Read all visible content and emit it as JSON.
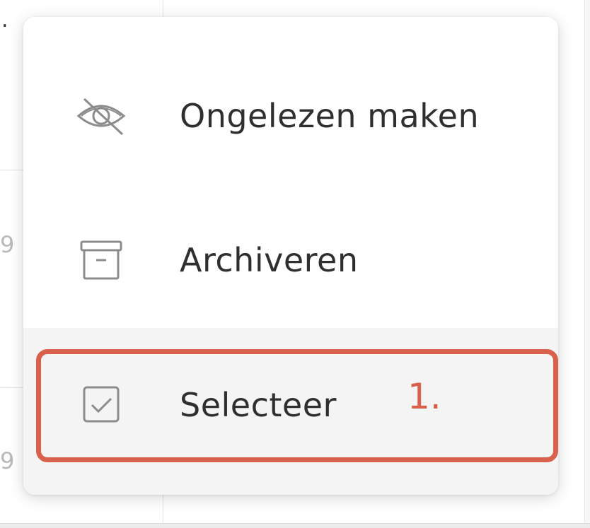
{
  "background": {
    "fragments": [
      "9",
      "9"
    ]
  },
  "menu": {
    "items": [
      {
        "label": "Ongelezen maken",
        "icon": "eye-off-icon"
      },
      {
        "label": "Archiveren",
        "icon": "archive-box-icon"
      },
      {
        "label": "Selecteer",
        "icon": "checkbox-checked-icon"
      }
    ]
  },
  "annotation": {
    "label": "1.",
    "color": "#d9604b"
  }
}
